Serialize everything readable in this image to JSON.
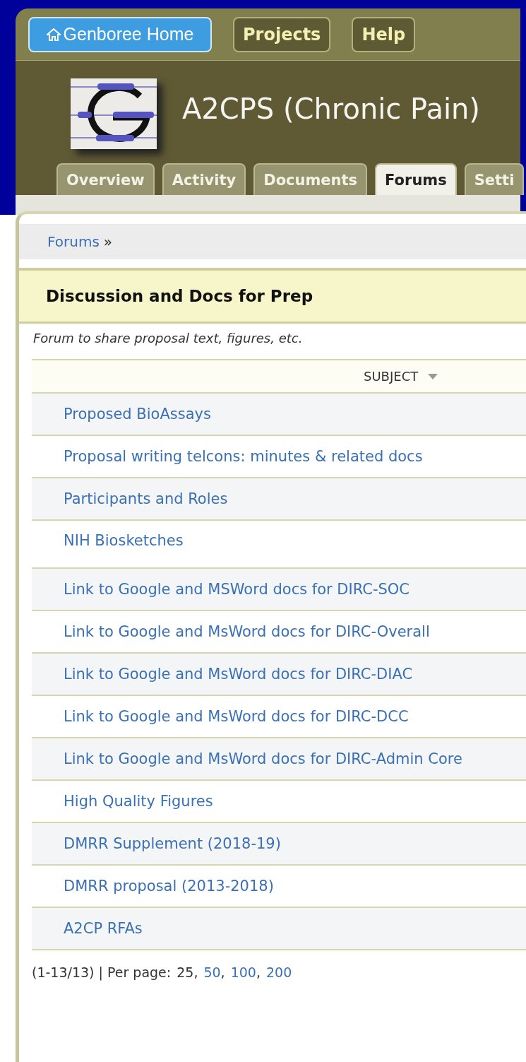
{
  "top_nav": [
    {
      "label": "Genboree Home",
      "kind": "home"
    },
    {
      "label": "Projects",
      "kind": "plain"
    },
    {
      "label": "Help",
      "kind": "plain"
    }
  ],
  "project": {
    "title": "A2CPS (Chronic Pain)"
  },
  "tabs": [
    {
      "label": "Overview",
      "selected": false
    },
    {
      "label": "Activity",
      "selected": false
    },
    {
      "label": "Documents",
      "selected": false
    },
    {
      "label": "Forums",
      "selected": true
    },
    {
      "label": "Setti",
      "selected": false
    }
  ],
  "breadcrumb": {
    "link": "Forums",
    "separator": "»"
  },
  "forum": {
    "title": "Discussion and Docs for Prep",
    "description": "Forum to share proposal text, figures, etc."
  },
  "table": {
    "columns": [
      {
        "label": "SUBJECT",
        "sorted": true
      }
    ],
    "rows": [
      {
        "subject": "Proposed BioAssays"
      },
      {
        "subject": "Proposal writing telcons: minutes & related docs"
      },
      {
        "subject": "Participants and Roles"
      },
      {
        "subject": "NIH Biosketches"
      },
      {
        "subject": "Link to Google and MSWord docs for DIRC-SOC"
      },
      {
        "subject": "Link to Google and MsWord docs for DIRC-Overall"
      },
      {
        "subject": "Link to Google and MsWord docs for DIRC-DIAC"
      },
      {
        "subject": "Link to Google and MsWord docs for DIRC-DCC"
      },
      {
        "subject": "Link to Google and MsWord docs for DIRC-Admin Core"
      },
      {
        "subject": "High Quality Figures"
      },
      {
        "subject": "DMRR Supplement (2018-19)"
      },
      {
        "subject": "DMRR proposal (2013-2018)"
      },
      {
        "subject": "A2CP RFAs"
      }
    ]
  },
  "pager": {
    "summary": "(1-13/13) | Per page:",
    "separator": ",",
    "options": [
      {
        "label": "25",
        "selected": true
      },
      {
        "label": "50",
        "selected": false
      },
      {
        "label": "100",
        "selected": false
      },
      {
        "label": "200",
        "selected": false
      }
    ]
  }
}
